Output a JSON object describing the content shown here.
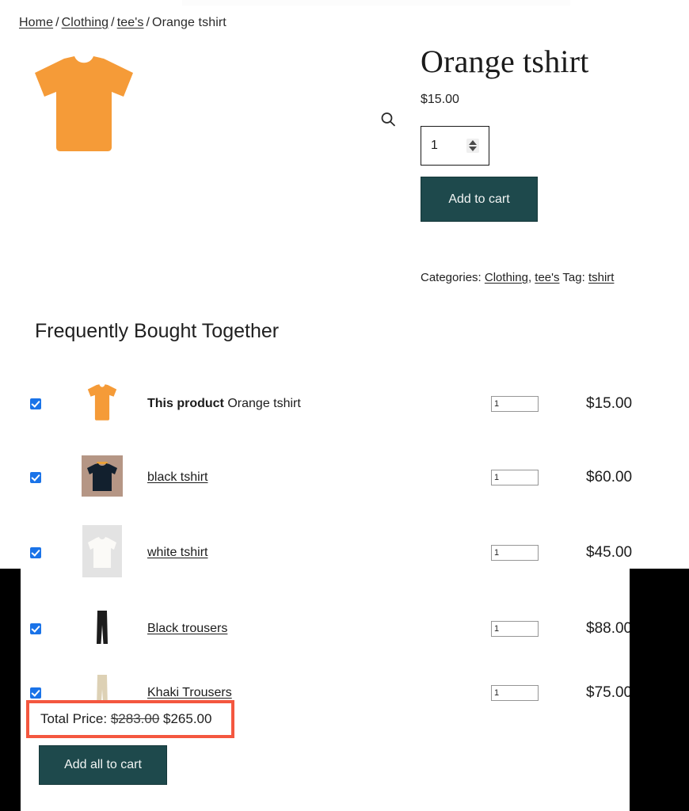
{
  "breadcrumb": {
    "items": [
      {
        "label": "Home",
        "link": true
      },
      {
        "label": "Clothing",
        "link": true
      },
      {
        "label": "tee's",
        "link": true
      },
      {
        "label": "Orange tshirt",
        "link": false
      }
    ],
    "separator": "/"
  },
  "gallery": {
    "zoom_icon": "search-icon",
    "main_image_alt": "Orange tshirt",
    "main_image_color": "#f59b38"
  },
  "summary": {
    "title": "Orange tshirt",
    "price": "$15.00",
    "quantity_value": "1",
    "add_to_cart_label": "Add to cart",
    "meta": {
      "categories_label": "Categories:",
      "categories": [
        "Clothing",
        "tee's"
      ],
      "tag_label": "Tag:",
      "tags": [
        "tshirt"
      ]
    }
  },
  "fbt": {
    "heading": "Frequently Bought Together",
    "rows": [
      {
        "checked": true,
        "this_product_label": "This product",
        "name": "Orange tshirt",
        "is_current": true,
        "qty": "1",
        "price": "$15.00",
        "thumb": "orange-tshirt"
      },
      {
        "checked": true,
        "this_product_label": "",
        "name": "black tshirt",
        "is_current": false,
        "qty": "1",
        "price": "$60.00",
        "thumb": "black-tshirt"
      },
      {
        "checked": true,
        "this_product_label": "",
        "name": "white tshirt",
        "is_current": false,
        "qty": "1",
        "price": "$45.00",
        "thumb": "white-tshirt"
      },
      {
        "checked": true,
        "this_product_label": "",
        "name": "Black trousers",
        "is_current": false,
        "qty": "1",
        "price": "$88.00",
        "thumb": "black-trousers"
      },
      {
        "checked": true,
        "this_product_label": "",
        "name": "Khaki Trousers",
        "is_current": false,
        "qty": "1",
        "price": "$75.00",
        "thumb": "khaki-trousers"
      }
    ],
    "total_label": "Total Price:",
    "total_original": "$283.00",
    "total_discounted": "$265.00",
    "add_all_label": "Add all to cart"
  },
  "colors": {
    "teal_button": "#1e494c",
    "checkbox_blue": "#1a73e8",
    "highlight_red": "#f4573f",
    "orange": "#f59b38"
  }
}
